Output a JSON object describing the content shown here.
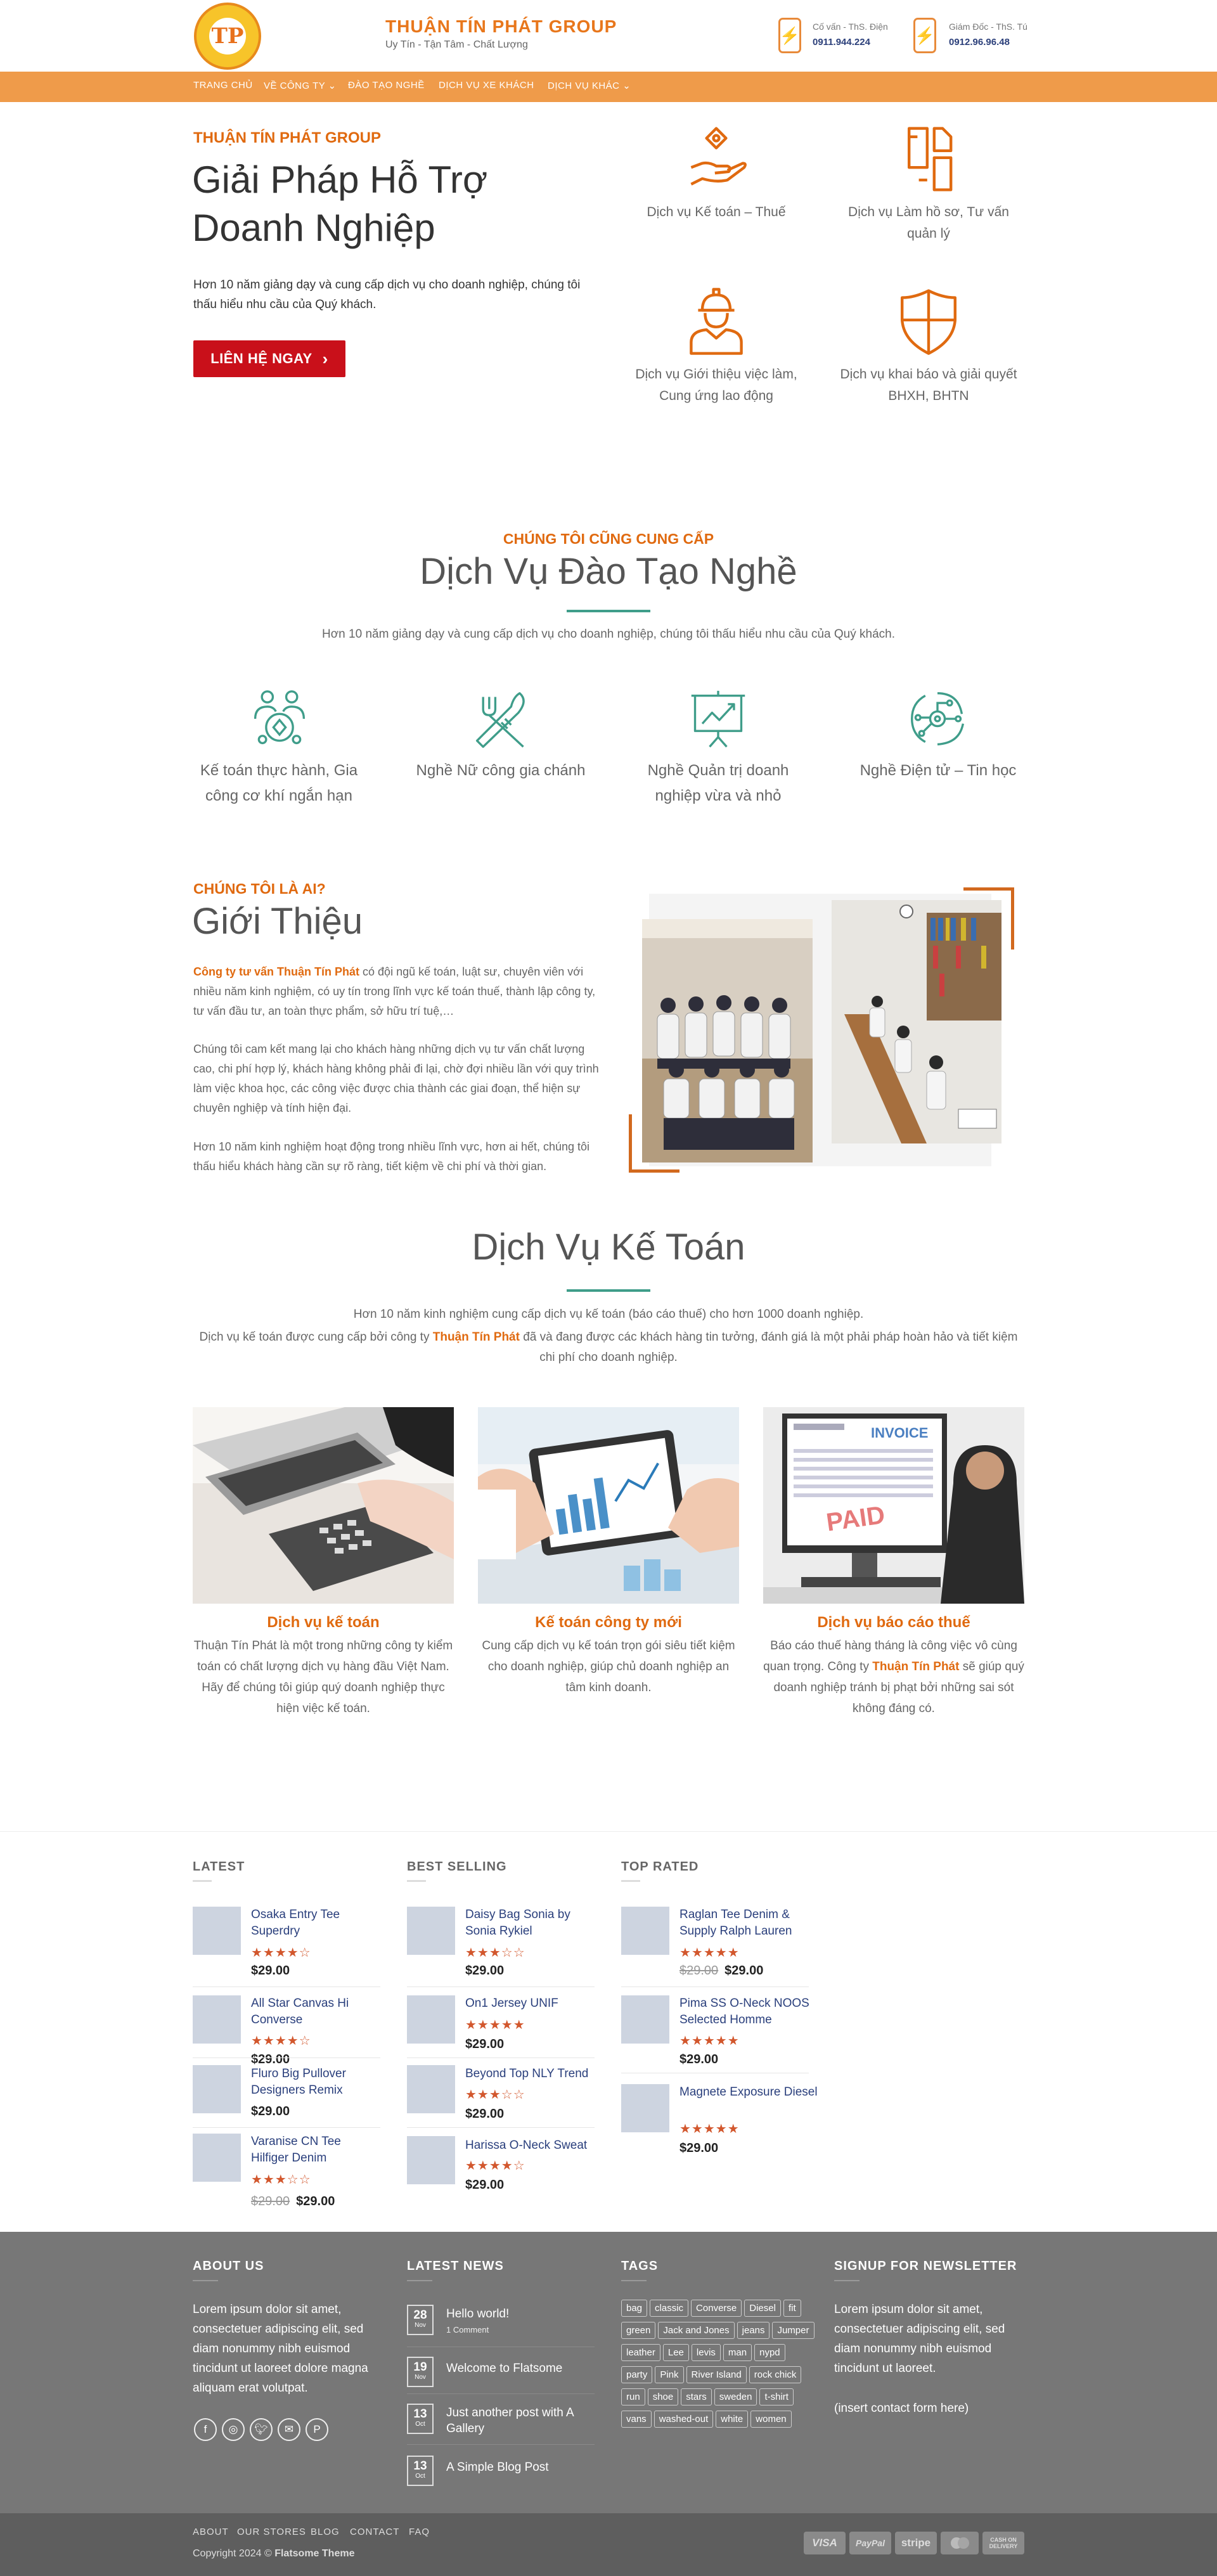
{
  "header": {
    "brand": "THUẬN TÍN PHÁT GROUP",
    "tagline": "Uy Tín - Tận Tâm - Chất Lượng",
    "logo_text": "TP",
    "contacts": [
      {
        "label": "Cố vấn - ThS. Điện",
        "number": "0911.944.224"
      },
      {
        "label": "Giám Đốc - ThS. Tú",
        "number": "0912.96.96.48"
      }
    ]
  },
  "nav": {
    "items": [
      "TRANG CHỦ",
      "VỀ CÔNG TY",
      "ĐÀO TẠO NGHỀ",
      "DỊCH VỤ XE KHÁCH",
      "DỊCH VỤ KHÁC"
    ],
    "dropdown_marker": "⌄"
  },
  "hero": {
    "kicker": "THUẬN TÍN PHÁT GROUP",
    "title": "Giải Pháp Hỗ Trợ Doanh Nghiệp",
    "description": "Hơn 10 năm giảng dạy và cung cấp dịch vụ cho doanh nghiệp, chúng tôi thấu hiểu nhu cầu của Quý khách.",
    "button": "LIÊN HỆ NGAY",
    "button_arrow": "›",
    "services": [
      {
        "label": "Dịch vụ Kế toán – Thuế",
        "icon": "hand-coin-icon"
      },
      {
        "label": "Dịch vụ Làm hồ sơ, Tư vấn quản lý",
        "icon": "documents-icon"
      },
      {
        "label": "Dịch vụ Giới thiệu việc làm, Cung ứng lao động",
        "icon": "worker-icon"
      },
      {
        "label": "Dịch vụ khai báo và giải quyết BHXH, BHTN",
        "icon": "shield-icon"
      }
    ]
  },
  "training": {
    "kicker": "CHÚNG TÔI CŨNG CUNG CẤP",
    "title": "Dịch Vụ Đào Tạo Nghề",
    "description": "Hơn 10 năm giảng dạy và cung cấp dịch vụ cho doanh nghiệp, chúng tôi thấu hiểu nhu cầu của Quý khách.",
    "items": [
      {
        "label": "Kế toán thực hành, Gia công cơ khí ngắn hạn",
        "icon": "people-coin-icon"
      },
      {
        "label": "Nghề Nữ công gia chánh",
        "icon": "kitchen-tools-icon"
      },
      {
        "label": "Nghề Quản trị doanh nghiệp vừa và nhỏ",
        "icon": "presentation-chart-icon"
      },
      {
        "label": "Nghề Điện tử – Tin học",
        "icon": "circuit-icon"
      }
    ]
  },
  "intro": {
    "kicker": "CHÚNG TÔI LÀ AI?",
    "title": "Giới Thiệu",
    "p1_highlight": "Công ty tư vấn Thuận Tín Phát",
    "p1_rest": " có đội ngũ kế toán, luật sư, chuyên viên với nhiều năm kinh nghiệm, có uy tín trong lĩnh vực kế toán thuế, thành lập công ty, tư vấn đầu tư, an toàn thực phẩm, sở hữu trí tuệ,…",
    "p2": "Chúng tôi cam kết mang lại cho khách hàng những dịch vụ tư vấn chất lượng cao, chi phí hợp lý, khách hàng không phải đi lại, chờ đợi nhiều lần với quy trình làm việc khoa học, các công việc được chia thành các giai đoạn, thể hiện sự chuyên nghiệp và tính hiện đại.",
    "p3": "Hơn 10 năm kinh nghiệm hoạt động trong nhiều lĩnh vực, hơn ai hết, chúng tôi thấu hiểu khách hàng cần sự rõ ràng, tiết kiệm về chi phí và thời gian."
  },
  "accounting": {
    "title": "Dịch Vụ Kế Toán",
    "desc1": "Hơn 10 năm kinh nghiệm cung cấp dịch vụ kế toán (báo cáo thuế) cho hơn 1000 doanh nghiệp.",
    "desc2_a": "Dịch vụ kế toán được cung cấp bởi công ty ",
    "desc2_highlight": "Thuận Tín Phát",
    "desc2_b": " đã và đang được các khách hàng tin tưởng, đánh giá là một phải pháp hoàn hảo và tiết kiệm chi phí cho doanh nghiệp.",
    "cards": [
      {
        "name": "Dịch vụ kế toán",
        "text_a": "Thuận Tín Phát là một trong những công ty kiểm toán có chất lượng dịch vụ hàng đầu Việt Nam. Hãy để chúng tôi giúp quý doanh nghiệp thực hiện việc kế toán.",
        "highlight": "",
        "text_b": ""
      },
      {
        "name": "Kế toán công ty mới",
        "text_a": "Cung cấp dịch vụ kế toán trọn gói siêu tiết kiệm cho doanh nghiệp, giúp chủ doanh nghiệp an tâm kinh doanh.",
        "highlight": "",
        "text_b": ""
      },
      {
        "name": "Dịch vụ báo cáo thuế",
        "text_a": "Báo cáo thuế hàng tháng là công việc vô cùng quan trọng. Công ty ",
        "highlight": "Thuận Tín Phát",
        "text_b": " sẽ giúp quý doanh nghiệp tránh bị phạt bởi những sai sót không đáng có."
      }
    ],
    "invoice_text": "INVOICE",
    "paid_text": "PAID"
  },
  "products": {
    "columns": [
      {
        "title": "LATEST",
        "items": [
          {
            "name": "Osaka Entry Tee Superdry",
            "stars": "★★★★☆",
            "old": "",
            "price": "$29.00"
          },
          {
            "name": "All Star Canvas Hi Converse",
            "stars": "★★★★☆",
            "old": "",
            "price": "$29.00"
          },
          {
            "name": "Fluro Big Pullover Designers Remix",
            "stars": "",
            "old": "",
            "price": "$29.00"
          },
          {
            "name": "Varanise CN Tee Hilfiger Denim",
            "stars": "★★★☆☆",
            "old": "$29.00",
            "price": "$29.00"
          }
        ]
      },
      {
        "title": "BEST SELLING",
        "items": [
          {
            "name": "Daisy Bag Sonia by Sonia Rykiel",
            "stars": "★★★☆☆",
            "old": "",
            "price": "$29.00"
          },
          {
            "name": "On1 Jersey UNIF",
            "stars": "★★★★★",
            "old": "",
            "price": "$29.00"
          },
          {
            "name": "Beyond Top NLY Trend",
            "stars": "★★★☆☆",
            "old": "",
            "price": "$29.00"
          },
          {
            "name": "Harissa O-Neck Sweat",
            "stars": "★★★★☆",
            "old": "",
            "price": "$29.00"
          }
        ]
      },
      {
        "title": "TOP RATED",
        "items": [
          {
            "name": "Raglan Tee Denim & Supply Ralph Lauren",
            "stars": "★★★★★",
            "old": "$29.00",
            "price": "$29.00"
          },
          {
            "name": "Pima SS O-Neck NOOS Selected Homme",
            "stars": "★★★★★",
            "old": "",
            "price": "$29.00"
          },
          {
            "name": "Magnete Exposure Diesel",
            "stars": "★★★★★",
            "old": "",
            "price": "$29.00"
          }
        ]
      }
    ]
  },
  "footer": {
    "about_title": "ABOUT US",
    "about_text": "Lorem ipsum dolor sit amet, consectetuer adipiscing elit, sed diam nonummy nibh euismod tincidunt ut laoreet dolore magna aliquam erat volutpat.",
    "social_icons": [
      "facebook-icon",
      "instagram-icon",
      "twitter-icon",
      "email-icon",
      "pinterest-icon"
    ],
    "news_title": "LATEST NEWS",
    "news": [
      {
        "day": "28",
        "month": "Nov",
        "title": "Hello world!",
        "sub": "1 Comment"
      },
      {
        "day": "19",
        "month": "Nov",
        "title": "Welcome to Flatsome",
        "sub": ""
      },
      {
        "day": "13",
        "month": "Oct",
        "title": "Just another post with A Gallery",
        "sub": ""
      },
      {
        "day": "13",
        "month": "Oct",
        "title": "A Simple Blog Post",
        "sub": ""
      }
    ],
    "tags_title": "TAGS",
    "tags": [
      "bag",
      "classic",
      "Converse",
      "Diesel",
      "fit",
      "green",
      "Jack and Jones",
      "jeans",
      "Jumper",
      "leather",
      "Lee",
      "levis",
      "man",
      "nypd",
      "party",
      "Pink",
      "River Island",
      "rock chick",
      "run",
      "shoe",
      "stars",
      "sweden",
      "t-shirt",
      "vans",
      "washed-out",
      "white",
      "women"
    ],
    "newsletter_title": "SIGNUP FOR NEWSLETTER",
    "newsletter_text": "Lorem ipsum dolor sit amet, consectetuer adipiscing elit, sed diam nonummy nibh euismod tincidunt ut laoreet.",
    "newsletter_placeholder": "(insert contact form here)",
    "bottom_links": [
      "ABOUT",
      "OUR STORES",
      "BLOG",
      "CONTACT",
      "FAQ"
    ],
    "copyright_a": "Copyright 2024 © ",
    "copyright_b": "Flatsome Theme",
    "payments": [
      "VISA",
      "PayPal",
      "stripe",
      "mastercard",
      "CASH ON DELIVERY"
    ]
  },
  "colors": {
    "accent": "#e06a10",
    "nav_bg": "#ef9b4a",
    "button": "#c9101a",
    "teal": "#3f9d8a",
    "footer": "#777777"
  }
}
